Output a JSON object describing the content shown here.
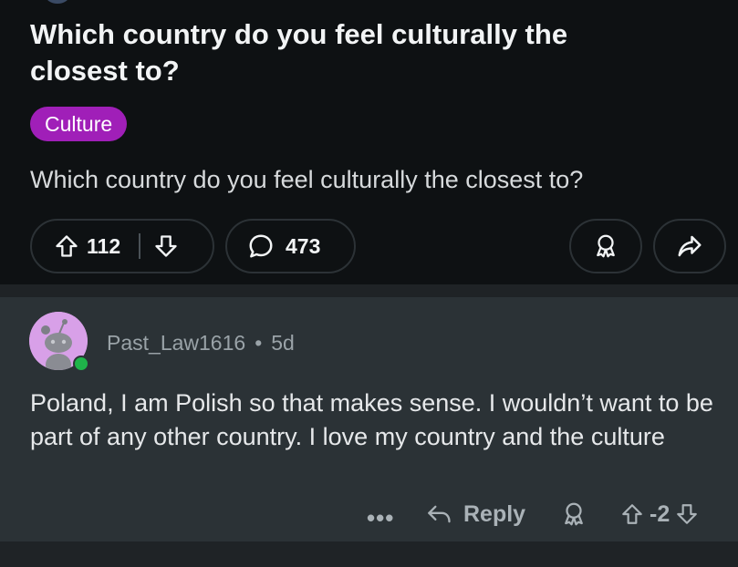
{
  "post": {
    "title": "Which country do you feel culturally the closest to?",
    "flair": "Culture",
    "body": "Which country do you feel culturally the closest to?",
    "score": "112",
    "comment_count": "473",
    "flair_color": "#a01fb8"
  },
  "comment": {
    "author": "Past_Law1616",
    "separator": "•",
    "age": "5d",
    "body": "Poland, I am Polish so that makes sense. I wouldn’t want to be part of any other country. I love my country and the culture",
    "more_label": "•••",
    "reply_label": "Reply",
    "score": "-2",
    "online_color": "#1fb34a"
  },
  "icons": {
    "upvote": "arrow-up-outline-icon",
    "downvote": "arrow-down-outline-icon",
    "comment": "speech-bubble-icon",
    "award": "award-ribbon-icon",
    "share": "share-arrow-icon",
    "reply": "reply-arrow-icon",
    "more": "ellipsis-icon"
  }
}
